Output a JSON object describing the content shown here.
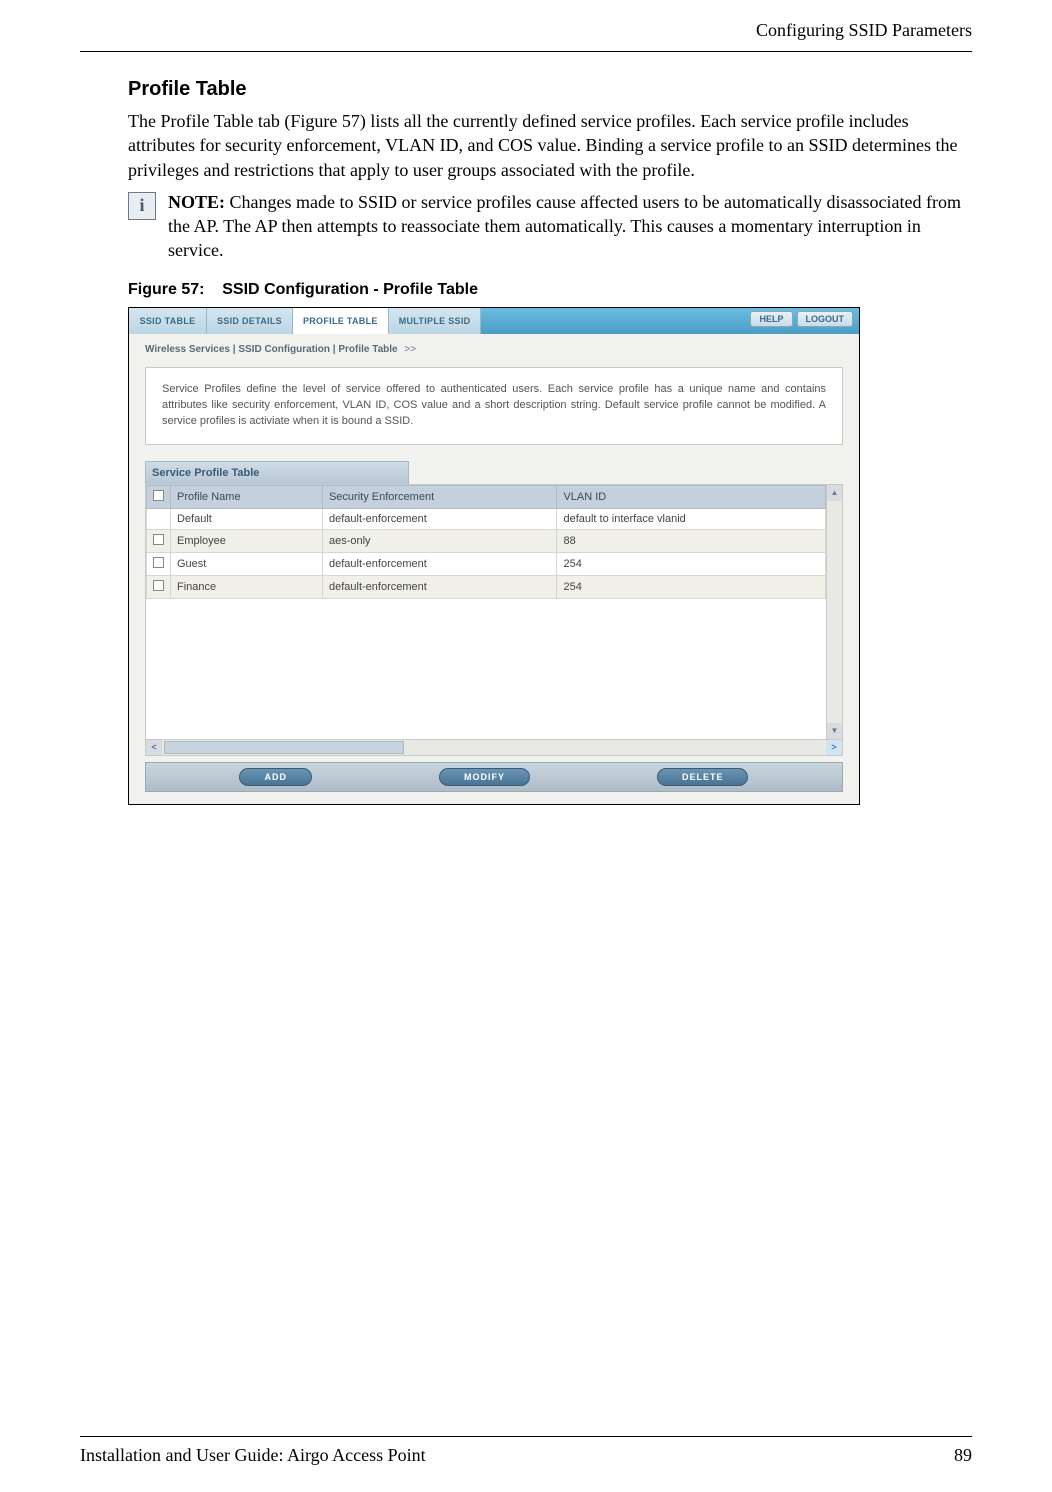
{
  "header": {
    "running_title": "Configuring SSID Parameters"
  },
  "section": {
    "title": "Profile Table",
    "body": "The Profile Table tab (Figure 57) lists all the currently defined service profiles. Each service profile includes attributes for security enforcement, VLAN ID, and COS value. Binding a service profile to an SSID determines the privileges and restrictions that apply to user groups associated with the profile."
  },
  "note": {
    "label": "NOTE:",
    "text": " Changes made to SSID or service profiles cause affected users to be automatically disassociated from the AP. The AP then attempts to reassociate them automatically. This causes a momentary interruption in service."
  },
  "figure": {
    "caption_num": "Figure 57:",
    "caption_text": "SSID Configuration - Profile Table"
  },
  "ui": {
    "tabs": [
      "SSID TABLE",
      "SSID DETAILS",
      "PROFILE TABLE",
      "MULTIPLE SSID"
    ],
    "active_tab_index": 2,
    "top_buttons": [
      "HELP",
      "LOGOUT"
    ],
    "breadcrumb": "Wireless Services | SSID Configuration | Profile Table",
    "breadcrumb_suffix": ">>",
    "description": "Service Profiles define the level of service offered to authenticated users. Each service profile has a unique name and contains attributes like security enforcement, VLAN ID, COS value and a short description string. Default service profile cannot be modified. A service profiles is activiate when it is bound a SSID.",
    "table_title": "Service Profile Table",
    "columns": [
      "Profile Name",
      "Security Enforcement",
      "VLAN ID"
    ],
    "rows": [
      {
        "checkbox": false,
        "name": "Default",
        "sec": "default-enforcement",
        "vlan": "default to interface vlanid",
        "has_checkbox": false
      },
      {
        "checkbox": false,
        "name": "Employee",
        "sec": "aes-only",
        "vlan": "88",
        "has_checkbox": true
      },
      {
        "checkbox": false,
        "name": "Guest",
        "sec": "default-enforcement",
        "vlan": "254",
        "has_checkbox": true
      },
      {
        "checkbox": false,
        "name": "Finance",
        "sec": "default-enforcement",
        "vlan": "254",
        "has_checkbox": true
      }
    ],
    "actions": [
      "ADD",
      "MODIFY",
      "DELETE"
    ]
  },
  "footer": {
    "left": "Installation and User Guide: Airgo Access Point",
    "right": "89"
  }
}
